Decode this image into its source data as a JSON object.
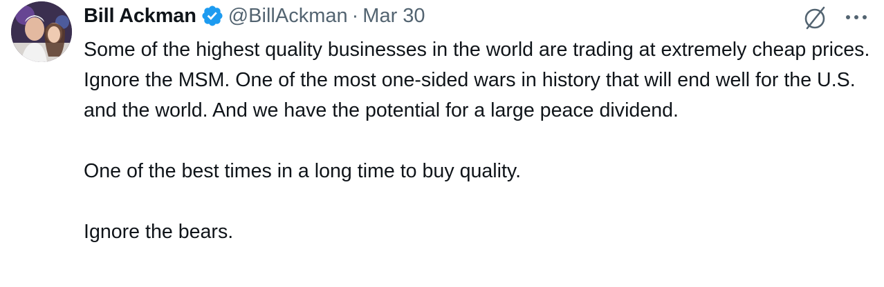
{
  "tweet": {
    "author_name": "Bill Ackman",
    "author_handle": "@BillAckman",
    "separator": "·",
    "date": "Mar 30",
    "verified": true,
    "accent_color": "#1d9bf0",
    "icons": [
      "verified-badge-icon",
      "grok-icon",
      "more-icon"
    ],
    "paragraphs": [
      "Some of the highest quality businesses in the world are trading at extremely cheap prices. Ignore the MSM. One of the most one-sided wars in history that will end well for the U.S. and the world. And we have the potential for a large peace dividend.",
      "One of the best times in a long time to buy quality.",
      "Ignore the bears."
    ]
  }
}
